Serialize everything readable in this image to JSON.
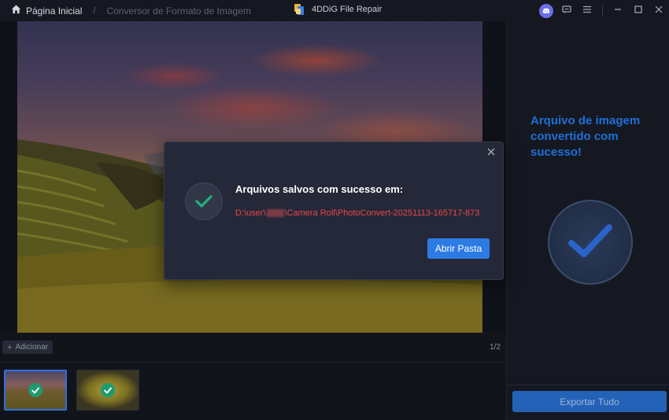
{
  "header": {
    "home_label": "Página Inicial",
    "separator": "/",
    "current_page": "Conversor de Formato de Imagem",
    "app_title": "4DDiG File Repair"
  },
  "toolbar": {
    "add_label": "Adicionar",
    "pager": "1/2"
  },
  "right_panel": {
    "success_message": "Arquivo de imagem convertido com sucesso!",
    "export_label": "Exportar Tudo"
  },
  "modal": {
    "title": "Arquivos salvos com sucesso em:",
    "path_prefix": "D:\\user\\",
    "path_suffix": "\\Camera Roll\\PhotoConvert-20251113-165717-873",
    "open_label": "Abrir Pasta"
  },
  "colors": {
    "accent": "#2c7be5",
    "success_text": "#1e6fd9",
    "path_text": "#e7474a",
    "check_green": "#1f9a6e"
  }
}
